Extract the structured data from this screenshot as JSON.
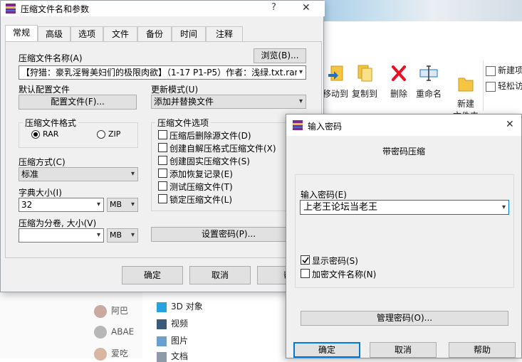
{
  "background": {
    "ribbon": [
      {
        "label": "移动到",
        "icon": "move-to-icon"
      },
      {
        "label": "复制到",
        "icon": "copy-to-icon"
      },
      {
        "label": "删除",
        "icon": "delete-icon"
      },
      {
        "label": "重命名",
        "icon": "rename-icon"
      },
      {
        "label": "新建\n文件夹",
        "icon": "new-folder-icon"
      }
    ],
    "ribbon_new_item": "新建项",
    "ribbon_easy_access": "轻松访",
    "nav_items": [
      {
        "label": "3D 对象",
        "icon": "3d-objects-icon"
      },
      {
        "label": "视频",
        "icon": "video-icon"
      },
      {
        "label": "图片",
        "icon": "pictures-icon"
      },
      {
        "label": "文档",
        "icon": "documents-icon"
      }
    ],
    "left_items": [
      "阿巴",
      "ABAE",
      "爱吃"
    ]
  },
  "main_dialog": {
    "title": "压缩文件名和参数",
    "help_glyph": "?",
    "close_glyph": "✕",
    "tabs": [
      "常规",
      "高级",
      "选项",
      "文件",
      "备份",
      "时间",
      "注释"
    ],
    "active_tab": 0,
    "archive_name_label": "压缩文件名称(A)",
    "browse_button": "浏览(B)...",
    "archive_name_value": "【狩猎：豪乳淫臀美妇们的极限肉欲】（1-17 P1-P5）作者：浅绿.txt.rar",
    "default_profile_label": "默认配置文件",
    "profile_button": "配置文件(F)...",
    "update_mode_label": "更新模式(U)",
    "update_mode_value": "添加并替换文件",
    "format_group": "压缩文件格式",
    "format_rar": "RAR",
    "format_zip": "ZIP",
    "selected_format": "RAR",
    "method_label": "压缩方式(C)",
    "method_value": "标准",
    "dict_label": "字典大小(I)",
    "dict_value": "32",
    "dict_unit": "MB",
    "split_label": "压缩为分卷, 大小(V)",
    "split_value": "",
    "split_unit": "MB",
    "options_group": "压缩文件选项",
    "options": [
      {
        "label": "压缩后删除源文件(D)",
        "checked": false
      },
      {
        "label": "创建自解压格式压缩文件(X)",
        "checked": false
      },
      {
        "label": "创建固实压缩文件(S)",
        "checked": false
      },
      {
        "label": "添加恢复记录(E)",
        "checked": false
      },
      {
        "label": "测试压缩文件(T)",
        "checked": false
      },
      {
        "label": "锁定压缩文件(L)",
        "checked": false
      }
    ],
    "set_password_button": "设置密码(P)...",
    "ok_button": "确定",
    "cancel_button": "取消",
    "help_button": "帮"
  },
  "password_dialog": {
    "title": "输入密码",
    "close_glyph": "✕",
    "heading": "带密码压缩",
    "password_label": "输入密码(E)",
    "password_value": "上老王论坛当老王",
    "show_password_label": "显示密码(S)",
    "show_password_checked": true,
    "encrypt_names_label": "加密文件名称(N)",
    "encrypt_names_checked": false,
    "manage_button": "管理密码(O)...",
    "ok_button": "确定",
    "cancel_button": "取消",
    "help_button": "帮助"
  },
  "colors": {
    "dialog_bg": "#f0f0f0",
    "button_bg": "#e1e1e1",
    "focus_border": "#0078d7",
    "delete_red": "#e81123",
    "folder_yellow": "#f4c542"
  }
}
